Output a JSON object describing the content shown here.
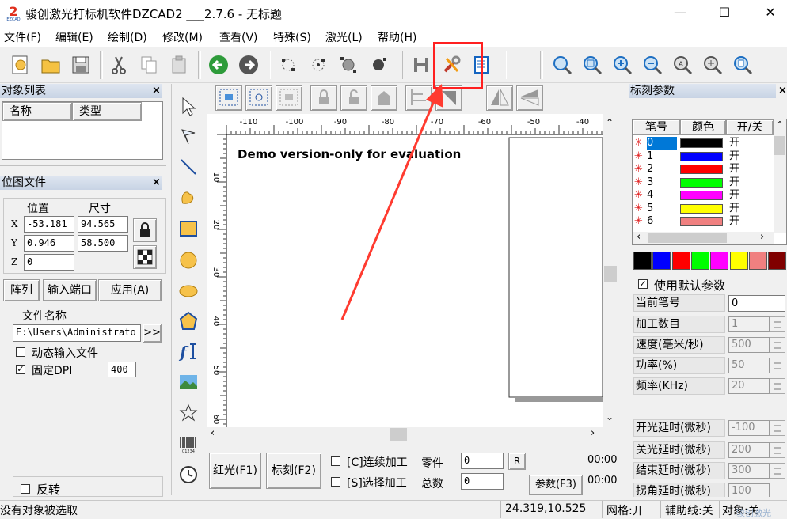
{
  "window": {
    "title": "骏创激光打标机软件DZCAD2 ___2.7.6 - 无标题",
    "minimize_glyph": "—",
    "maximize_glyph": "☐",
    "close_glyph": "✕"
  },
  "menu": [
    "文件(F)",
    "编辑(E)",
    "绘制(D)",
    "修改(M)",
    "查看(V)",
    "特殊(S)",
    "激光(L)",
    "帮助(H)"
  ],
  "object_list": {
    "title": "对象列表",
    "col_name": "名称",
    "col_type": "类型"
  },
  "bitmap_panel": {
    "title": "位图文件",
    "pos_label": "位置",
    "size_label": "尺寸",
    "x_label": "X",
    "y_label": "Y",
    "z_label": "Z",
    "x_pos": "-53.181",
    "x_size": "94.565",
    "y_pos": "0.946",
    "y_size": "58.500",
    "z_pos": "0",
    "array_btn": "阵列",
    "input_port_btn": "输入端口",
    "apply_btn": "应用(A)",
    "file_name_label": "文件名称",
    "file_path": "E:\\Users\\Administrato",
    "browse_btn": ">>",
    "dynamic_input_label": "动态输入文件",
    "fixed_dpi_label": "固定DPI",
    "dpi_value": "400",
    "invert_label": "反转"
  },
  "canvas": {
    "demo_text": "Demo version-only for evaluation",
    "ruler_h_labels": [
      "-110",
      "-100",
      "-90",
      "-80",
      "-70",
      "-60",
      "-50",
      "-40"
    ],
    "ruler_v_labels": [
      "10",
      "20",
      "30",
      "40",
      "50",
      "60"
    ]
  },
  "bottom": {
    "red_light_btn": "红光(F1)",
    "mark_btn": "标刻(F2)",
    "continuous_label": "[C]连续加工",
    "select_label": "[S]选择加工",
    "part_label": "零件",
    "total_label": "总数",
    "part_value": "0",
    "total_value": "0",
    "r_btn": "R",
    "time1": "00:00",
    "time2": "00:00",
    "params_btn": "参数(F3)"
  },
  "mark_params": {
    "title": "标刻参数",
    "col_pen": "笔号",
    "col_color": "颜色",
    "col_onoff": "开/关",
    "pens": [
      {
        "no": "0",
        "color": "#000000",
        "state": "开"
      },
      {
        "no": "1",
        "color": "#0000ff",
        "state": "开"
      },
      {
        "no": "2",
        "color": "#ff0000",
        "state": "开"
      },
      {
        "no": "3",
        "color": "#00ff00",
        "state": "开"
      },
      {
        "no": "4",
        "color": "#ff00ff",
        "state": "开"
      },
      {
        "no": "5",
        "color": "#ffff00",
        "state": "开"
      },
      {
        "no": "6",
        "color": "#f08080",
        "state": "开"
      }
    ],
    "palette": [
      "#000000",
      "#0000ff",
      "#ff0000",
      "#00ff00",
      "#ff00ff",
      "#ffff00",
      "#f08080",
      "#800000"
    ],
    "use_default_label": "使用默认参数",
    "current_pen_label": "当前笔号",
    "current_pen_value": "0",
    "count_label": "加工数目",
    "count_value": "1",
    "speed_label": "速度(毫米/秒)",
    "speed_value": "500",
    "power_label": "功率(%)",
    "power_value": "50",
    "freq_label": "频率(KHz)",
    "freq_value": "20",
    "on_delay_label": "开光延时(微秒)",
    "on_delay_value": "-100",
    "off_delay_label": "关光延时(微秒)",
    "off_delay_value": "200",
    "end_delay_label": "结束延时(微秒)",
    "end_delay_value": "300",
    "corner_delay_label": "拐角延时(微秒)",
    "corner_delay_value": "100"
  },
  "statusbar": {
    "message": "没有对象被选取",
    "coords": "24.319,10.525",
    "grid": "网格:开",
    "guide": "辅助线:关",
    "object": "对象:关",
    "watermark": "骏创激光"
  },
  "colors": {
    "highlight_box": "#ff2020",
    "arrow": "#ff3b30",
    "selection_blue": "#0078d7"
  }
}
